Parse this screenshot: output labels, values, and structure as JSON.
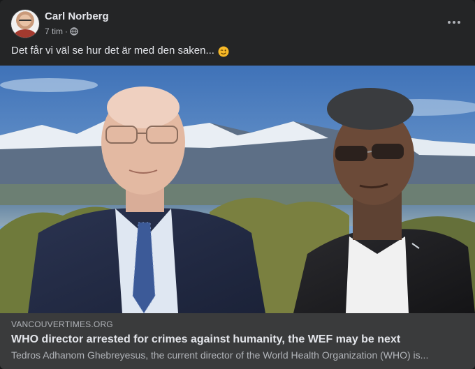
{
  "post": {
    "author": "Carl Norberg",
    "time": "7 tim",
    "separator": "·",
    "privacy_icon": "globe-icon",
    "text": "Det får vi väl se hur det är med den saken...",
    "emoji": "wink-emoji",
    "more_icon": "more-options-icon"
  },
  "link": {
    "domain": "VANCOUVERTIMES.ORG",
    "title": "WHO director arrested for crimes against humanity, the WEF may be next",
    "description": "Tedros Adhanom Ghebreyesus, the current director of the World Health Organization (WHO) is..."
  },
  "colors": {
    "card_bg": "#242526",
    "link_bg": "#3a3b3c",
    "primary_text": "#e4e6eb",
    "secondary_text": "#b0b3b8"
  }
}
